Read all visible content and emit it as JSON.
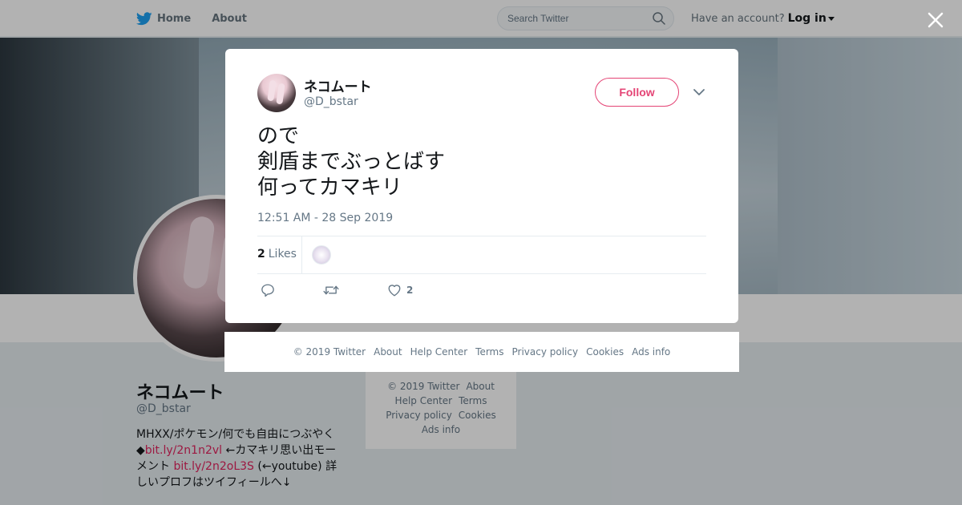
{
  "nav": {
    "home_label": "Home",
    "about_label": "About",
    "search_placeholder": "Search Twitter",
    "account_prompt": "Have an account?",
    "login_label": "Log in"
  },
  "profile": {
    "name": "ネコムート",
    "handle": "@D_bstar",
    "bio_text_1": "MHXX/ポケモン/何でも自由につぶやく◆",
    "bio_link_1": "bit.ly/2n1n2vl",
    "bio_text_2": " ←カマキリ思い出モーメント ",
    "bio_link_2": "bit.ly/2n2oL3S",
    "bio_text_3": " (←youtube) 詳しいプロフはツイフィールへ↓"
  },
  "side_footer": {
    "copyright": "© 2019 Twitter",
    "about": "About",
    "help": "Help Center",
    "terms": "Terms",
    "privacy": "Privacy policy",
    "cookies": "Cookies",
    "ads": "Ads info"
  },
  "tweet": {
    "name": "ネコムート",
    "handle": "@D_bstar",
    "follow_label": "Follow",
    "text": "ので\n剣盾までぶっとばす\n何ってカマキリ",
    "timestamp": "12:51 AM - 28 Sep 2019",
    "likes_count": "2",
    "likes_label": "Likes",
    "like_action_count": "2"
  },
  "modal_footer": {
    "copyright": "© 2019 Twitter",
    "about": "About",
    "help": "Help Center",
    "terms": "Terms",
    "privacy": "Privacy policy",
    "cookies": "Cookies",
    "ads": "Ads info"
  },
  "colors": {
    "accent": "#e0245e",
    "twitter_blue": "#1da1f2",
    "secondary_text": "#657786"
  },
  "icons": {
    "logo": "twitter-bird-icon",
    "search": "search-icon",
    "close": "close-icon",
    "chevron": "chevron-down-icon",
    "reply": "reply-icon",
    "retweet": "retweet-icon",
    "like": "heart-icon"
  }
}
